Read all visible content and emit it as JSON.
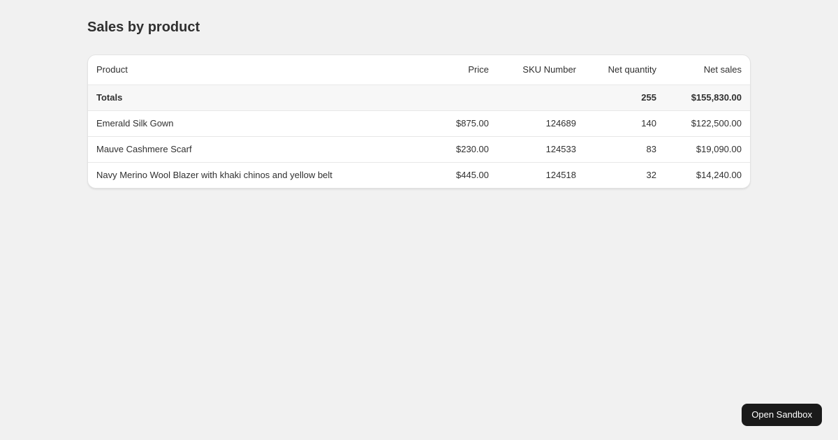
{
  "page": {
    "title": "Sales by product"
  },
  "table": {
    "columns": {
      "product": "Product",
      "price": "Price",
      "sku": "SKU Number",
      "net_quantity": "Net quantity",
      "net_sales": "Net sales"
    },
    "totals": {
      "label": "Totals",
      "price": "",
      "sku": "",
      "net_quantity": "255",
      "net_sales": "$155,830.00"
    },
    "rows": [
      {
        "product": "Emerald Silk Gown",
        "price": "$875.00",
        "sku": "124689",
        "net_quantity": "140",
        "net_sales": "$122,500.00"
      },
      {
        "product": "Mauve Cashmere Scarf",
        "price": "$230.00",
        "sku": "124533",
        "net_quantity": "83",
        "net_sales": "$19,090.00"
      },
      {
        "product": "Navy Merino Wool Blazer with khaki chinos and yellow belt",
        "price": "$445.00",
        "sku": "124518",
        "net_quantity": "32",
        "net_sales": "$14,240.00"
      }
    ]
  },
  "sandbox_button": {
    "label": "Open Sandbox"
  },
  "colors": {
    "background": "#f1f1f1",
    "card": "#ffffff",
    "totals_row_bg": "#f7f7f7",
    "divider": "#e7e7e7",
    "text": "#303030",
    "button_bg": "#1a1a1a",
    "button_text": "#ffffff"
  }
}
